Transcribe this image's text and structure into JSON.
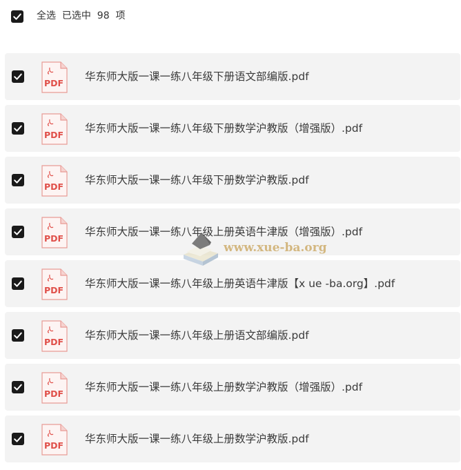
{
  "header": {
    "select_all_label": "全选",
    "selected_text": "已选中  98  项"
  },
  "files": [
    {
      "name": "",
      "type": "PDF"
    },
    {
      "name": "华东师大版一课一练八年级下册语文部编版.pdf",
      "type": "PDF"
    },
    {
      "name": "华东师大版一课一练八年级下册数学沪教版（增强版）.pdf",
      "type": "PDF"
    },
    {
      "name": "华东师大版一课一练八年级下册数学沪教版.pdf",
      "type": "PDF"
    },
    {
      "name": "华东师大版一课一练八年级上册英语牛津版（增强版）.pdf",
      "type": "PDF"
    },
    {
      "name": "华东师大版一课一练八年级上册英语牛津版【x ue -ba.org】.pdf",
      "type": "PDF"
    },
    {
      "name": "华东师大版一课一练八年级上册语文部编版.pdf",
      "type": "PDF"
    },
    {
      "name": "华东师大版一课一练八年级上册数学沪教版（增强版）.pdf",
      "type": "PDF"
    },
    {
      "name": "华东师大版一课一练八年级上册数学沪教版.pdf",
      "type": "PDF"
    }
  ],
  "watermark": {
    "text": "www.xue-ba.org"
  },
  "colors": {
    "row_bg": "#f3f3f3",
    "checkbox": "#1a1a1a",
    "pdf_red": "#e0504a"
  },
  "icons": {
    "checkbox": "checkbox-checked-icon",
    "file": "pdf-file-icon"
  }
}
